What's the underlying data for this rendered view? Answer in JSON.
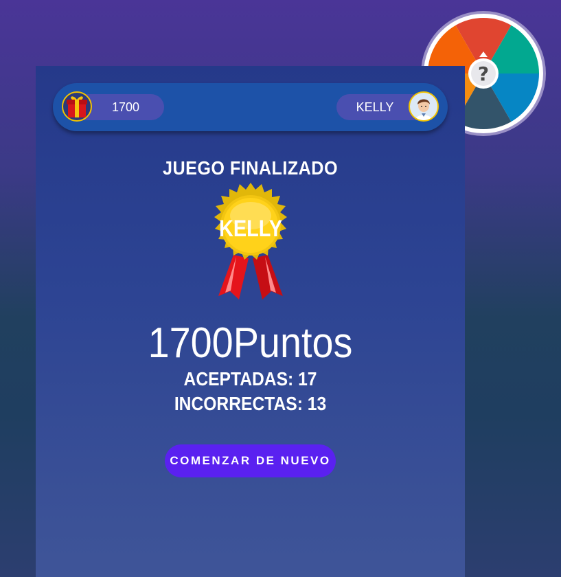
{
  "header": {
    "points": "1700",
    "player_name": "KELLY"
  },
  "result": {
    "title": "JUEGO FINALIZADO",
    "medal_name": "KELLY",
    "score": "1700",
    "score_unit": "Puntos",
    "correct_label": "ACEPTADAS: 17",
    "incorrect_label": "INCORRECTAS: 13"
  },
  "actions": {
    "restart_label": "COMENZAR DE NUEVO"
  },
  "icons": {
    "gift": "gift-icon",
    "user": "user-avatar-icon",
    "medal": "medal-icon",
    "wheel": "question-wheel-icon"
  },
  "colors": {
    "wheel_segments": [
      "#e04530",
      "#02a890",
      "#0686c4",
      "#33546a",
      "#f58d10",
      "#f46207"
    ],
    "button": "#5a21f0",
    "topbar": "#1d52a8"
  }
}
